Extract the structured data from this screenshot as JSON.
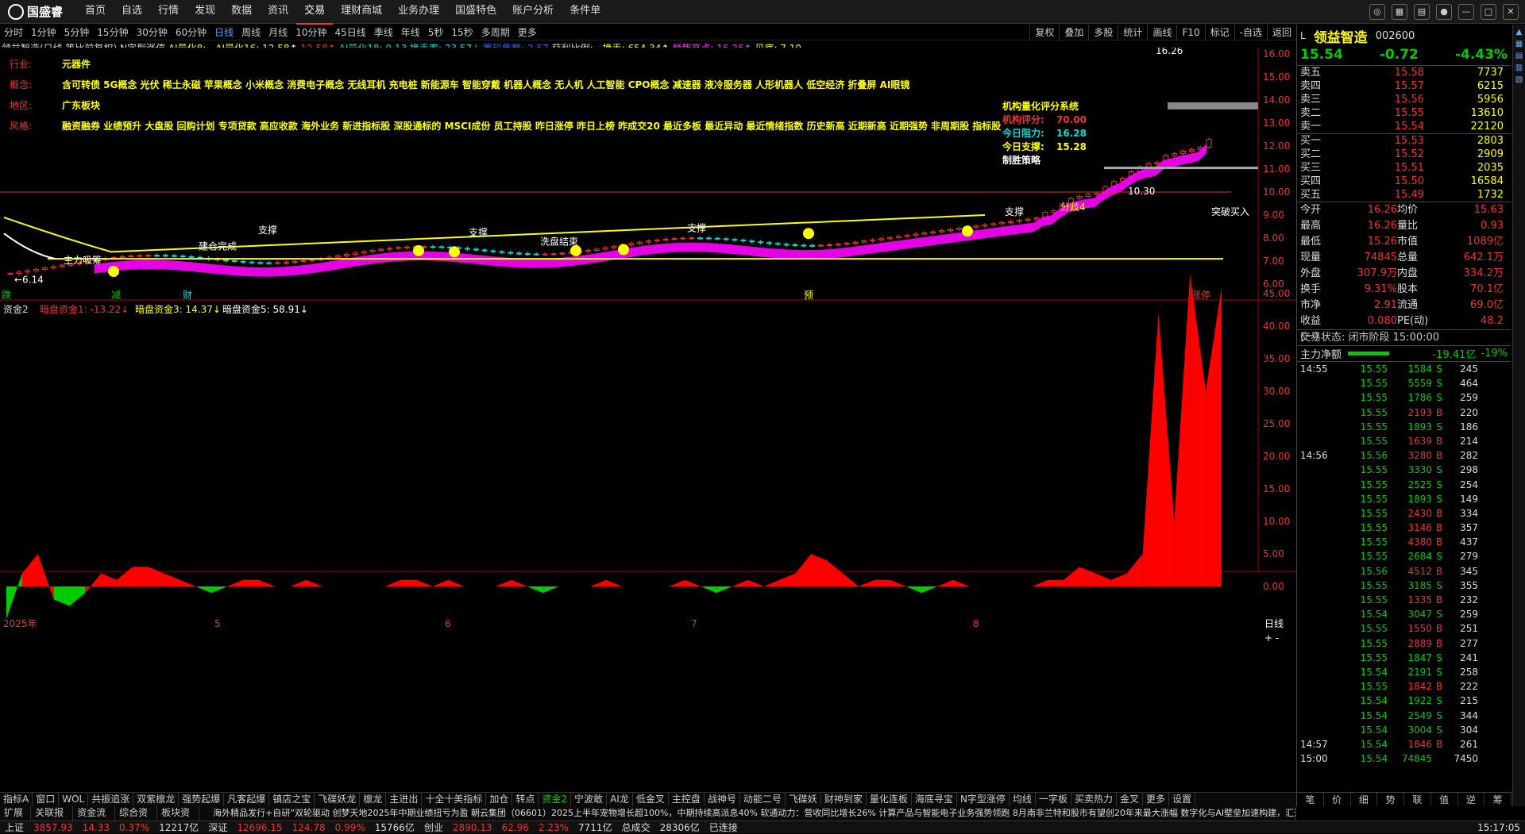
{
  "app": {
    "logo": "国盛睿",
    "menu": [
      "首页",
      "自选",
      "行情",
      "发现",
      "数据",
      "资讯",
      "交易",
      "理财商城",
      "业务办理",
      "国盛特色",
      "账户分析",
      "条件单"
    ],
    "active_menu": "交易"
  },
  "periods": [
    "分时",
    "1分钟",
    "5分钟",
    "15分钟",
    "30分钟",
    "60分钟",
    "日线",
    "周线",
    "月线",
    "10分钟",
    "45日线",
    "季线",
    "年线",
    "5秒",
    "15秒",
    "多周期",
    "更多"
  ],
  "active_period": "日线",
  "tools": [
    "复权",
    "叠加",
    "多股",
    "统计",
    "画线",
    "F10",
    "标记",
    "-自选",
    "返回"
  ],
  "info": {
    "name": "领益智造(日线,等比前复权)",
    "ind": "N字型涨停",
    "ai8": "AI量化8: -",
    "ai16": "AI量化16: 12.58↑",
    "v1": "12.58↑",
    "ai18": "AI量化18: 9.13",
    "hs": "换手率: 23.57↓",
    "hsv": "筹码集聚: 2.57",
    "pr": "获利比例: -",
    "hand": "换手: 654.34↑",
    "top": "趋势高点: 16.26↑",
    "low": "见底: 7.10"
  },
  "notes": [
    {
      "k": "行业:",
      "v": "元器件"
    },
    {
      "k": "概念:",
      "v": "含可转债 5G概念 光伏 稀土永磁 苹果概念 小米概念 消费电子概念 无线耳机 充电桩 新能源车 智能穿戴 机器人概念 无人机 人工智能 CPO概念 减速器 液冷服务器 人形机器人 低空经济 折叠屏 AI眼镜"
    },
    {
      "k": "地区:",
      "v": "广东板块"
    },
    {
      "k": "风格:",
      "v": "融资融券 业绩预升 大盘股 回购计划 专项贷款 高应收款 海外业务 新进指标股 深股通标的 MSCI成份 员工持股 昨日涨停 昨日上榜 昨成交20 最近多板 最近异动 最近情绪指数 历史新高 近期新高 近期强势 非周期股 指标股"
    }
  ],
  "sys": {
    "title": "机构量化评分系统",
    "score_k": "机构评分:",
    "score_v": "70.00",
    "res_k": "今日阻力:",
    "res_v": "16.28",
    "sup_k": "今日支撑:",
    "sup_v": "15.28",
    "win": "制胜策略"
  },
  "chart_labels": {
    "zhuli": "主力吸筹",
    "jiancang": "建仓完成",
    "xipan": "洗盘结束",
    "zc1": "支撑",
    "zc2": "支撑",
    "zc3": "支撑",
    "zc4": "支撑",
    "fj4": "分歧4",
    "tpmr": "突破买入",
    "p1626": "16.26",
    "p1030": "10.30",
    "p614": "←6.14",
    "zt": "涨停",
    "d1": "跌",
    "d2": "财",
    "d3": "减",
    "d4": "预"
  },
  "price_axis": [
    "16.00",
    "15.00",
    "14.00",
    "13.00",
    "12.00",
    "11.00",
    "10.00",
    "9.00",
    "8.00",
    "7.00",
    "6.00"
  ],
  "sub_info": {
    "name": "资金2",
    "a": "暗盘资金1: -13.22↓",
    "b": "暗盘资金3: 14.37↓",
    "c": "暗盘资金5: 58.91↓"
  },
  "sub_axis": [
    "45.00",
    "40.00",
    "35.00",
    "30.00",
    "25.00",
    "20.00",
    "15.00",
    "10.00",
    "5.00",
    "0.00"
  ],
  "months": [
    "2025年",
    "5",
    "6",
    "7",
    "8"
  ],
  "daily_label": "日线",
  "quote": {
    "name": "领益智造",
    "code": "002600",
    "price": "15.54",
    "chg": "-0.72",
    "pct": "-4.43%"
  },
  "asks": [
    {
      "l": "卖五",
      "p": "15.58",
      "q": "7737"
    },
    {
      "l": "卖四",
      "p": "15.57",
      "q": "6215"
    },
    {
      "l": "卖三",
      "p": "15.56",
      "q": "5956"
    },
    {
      "l": "卖二",
      "p": "15.55",
      "q": "13610"
    },
    {
      "l": "卖一",
      "p": "15.54",
      "q": "22120"
    }
  ],
  "bids": [
    {
      "l": "买一",
      "p": "15.53",
      "q": "2803"
    },
    {
      "l": "买二",
      "p": "15.52",
      "q": "2909"
    },
    {
      "l": "买三",
      "p": "15.51",
      "q": "2035"
    },
    {
      "l": "买四",
      "p": "15.50",
      "q": "16584"
    },
    {
      "l": "买五",
      "p": "15.49",
      "q": "1732"
    }
  ],
  "stats": [
    [
      "今开",
      "16.26",
      "均价",
      "15.63"
    ],
    [
      "最高",
      "16.26",
      "量比",
      "0.93"
    ],
    [
      "最低",
      "15.26",
      "市值",
      "1089亿"
    ],
    [
      "现量",
      "74845",
      "总量",
      "642.1万"
    ],
    [
      "外盘",
      "307.9万",
      "内盘",
      "334.2万"
    ],
    [
      "换手",
      "9.31%",
      "股本",
      "70.1亿"
    ],
    [
      "市净",
      "2.91",
      "流通",
      "69.0亿"
    ],
    [
      "收益(一)",
      "0.080",
      "PE(动)",
      "48.2"
    ]
  ],
  "trade_state": "交易状态: 闭市阶段 15:00:00",
  "main_net": {
    "k": "主力净额",
    "v": "-19.41亿",
    "p": "-19%"
  },
  "ticks": [
    [
      "14:55",
      "15.55",
      "1584",
      "S",
      "245"
    ],
    [
      "",
      "15.55",
      "5559",
      "S",
      "464"
    ],
    [
      "",
      "15.55",
      "1786",
      "S",
      "259"
    ],
    [
      "",
      "15.55",
      "2193",
      "B",
      "220"
    ],
    [
      "",
      "15.55",
      "1893",
      "S",
      "186"
    ],
    [
      "",
      "15.55",
      "1639",
      "B",
      "214"
    ],
    [
      "14:56",
      "15.56",
      "3280",
      "B",
      "282"
    ],
    [
      "",
      "15.55",
      "3330",
      "S",
      "298"
    ],
    [
      "",
      "15.55",
      "2525",
      "S",
      "254"
    ],
    [
      "",
      "15.55",
      "1893",
      "S",
      "149"
    ],
    [
      "",
      "15.55",
      "2430",
      "B",
      "334"
    ],
    [
      "",
      "15.55",
      "3146",
      "B",
      "357"
    ],
    [
      "",
      "15.55",
      "4380",
      "B",
      "437"
    ],
    [
      "",
      "15.55",
      "2684",
      "S",
      "279"
    ],
    [
      "",
      "15.56",
      "4512",
      "B",
      "345"
    ],
    [
      "",
      "15.55",
      "3185",
      "S",
      "355"
    ],
    [
      "",
      "15.55",
      "1335",
      "B",
      "232"
    ],
    [
      "",
      "15.54",
      "3047",
      "S",
      "259"
    ],
    [
      "",
      "15.55",
      "1550",
      "B",
      "251"
    ],
    [
      "",
      "15.55",
      "2889",
      "B",
      "277"
    ],
    [
      "",
      "15.55",
      "1847",
      "S",
      "241"
    ],
    [
      "",
      "15.54",
      "2191",
      "S",
      "258"
    ],
    [
      "",
      "15.55",
      "1842",
      "B",
      "222"
    ],
    [
      "",
      "15.54",
      "1922",
      "S",
      "215"
    ],
    [
      "",
      "15.54",
      "2549",
      "S",
      "344"
    ],
    [
      "",
      "15.54",
      "3004",
      "S",
      "304"
    ],
    [
      "14:57",
      "15.54",
      "1846",
      "B",
      "261"
    ],
    [
      "15:00",
      "15.54",
      "74845",
      "",
      "7450"
    ]
  ],
  "rp_tabs": [
    "笔",
    "价",
    "细",
    "势",
    "联",
    "值",
    "逆",
    "筹"
  ],
  "bottom_tabs": [
    "指标A",
    "窗口",
    "WOL",
    "共振追涨",
    "双紫檩龙",
    "强势起爆",
    "凡客起爆",
    "镇店之宝",
    "飞碟妖龙",
    "檩龙",
    "主进出",
    "十全十美指标",
    "加仓",
    "转点",
    "资金2",
    "宁波敢",
    "AI龙",
    "低金叉",
    "主控盘",
    "战神号",
    "动能二号",
    "飞碟妖",
    "财神到家",
    "量化连板",
    "海底寻宝",
    "N字型涨停",
    "均线",
    "一字板",
    "买卖热力",
    "金叉",
    "更多",
    "设置"
  ],
  "bottom_active": "资金2",
  "bottom2": [
    "扩展A",
    "关联报价",
    "资金流向",
    "综合资讯",
    "板块资讯"
  ],
  "news": "海外精品发行+自研”双轮驱动 创梦天地2025年中期业绩扭亏为盈   朝云集团（06601）2025上半年宠物增长超100%，中期持续高派息40%   软通动力：营收同比增长26% 计算产品与智能电子业务强势领跑   8月南非兰特和股市有望创20年来最大涨幅   数字化与AI壁垒加速构建，汇通达网络(09878)或成“下沉市场AI第一",
  "status": {
    "sh_k": "上证",
    "sh": "3857.93",
    "sh_c": "14.33",
    "sh_p": "0.37%",
    "sh_v": "12217亿",
    "sz_k": "深证",
    "sz": "12696.15",
    "sz_c": "124.78",
    "sz_p": "0.99%",
    "sz_v": "15766亿",
    "cy_k": "创业",
    "cy": "2890.13",
    "cy_c": "62.96",
    "cy_p": "2.23%",
    "cy_v": "7711亿",
    "tot_k": "总成交",
    "tot": "28306亿",
    "conn": "已连接",
    "time": "15:17:05"
  },
  "chart_data": {
    "type": "area",
    "title": "资金2",
    "series": [
      {
        "name": "暗盘资金1",
        "values": [
          -5,
          2,
          5,
          -2,
          -3,
          -1,
          2,
          1,
          3,
          3,
          2,
          1,
          0,
          -1,
          0,
          1,
          1,
          0,
          0,
          1,
          0,
          0,
          0,
          0,
          0,
          1,
          1,
          0,
          1,
          0,
          0,
          0,
          1,
          0,
          -1,
          0,
          0,
          0,
          1,
          0,
          0,
          0,
          0,
          1,
          0,
          -1,
          0,
          1,
          0,
          1,
          2,
          5,
          4,
          2,
          0,
          1,
          1,
          0,
          -1,
          0,
          1,
          0,
          0,
          0,
          0,
          0,
          1,
          1,
          3,
          2,
          1,
          2,
          5,
          42,
          10,
          48,
          30,
          46
        ]
      }
    ],
    "ylim": [
      -5,
      50
    ]
  }
}
